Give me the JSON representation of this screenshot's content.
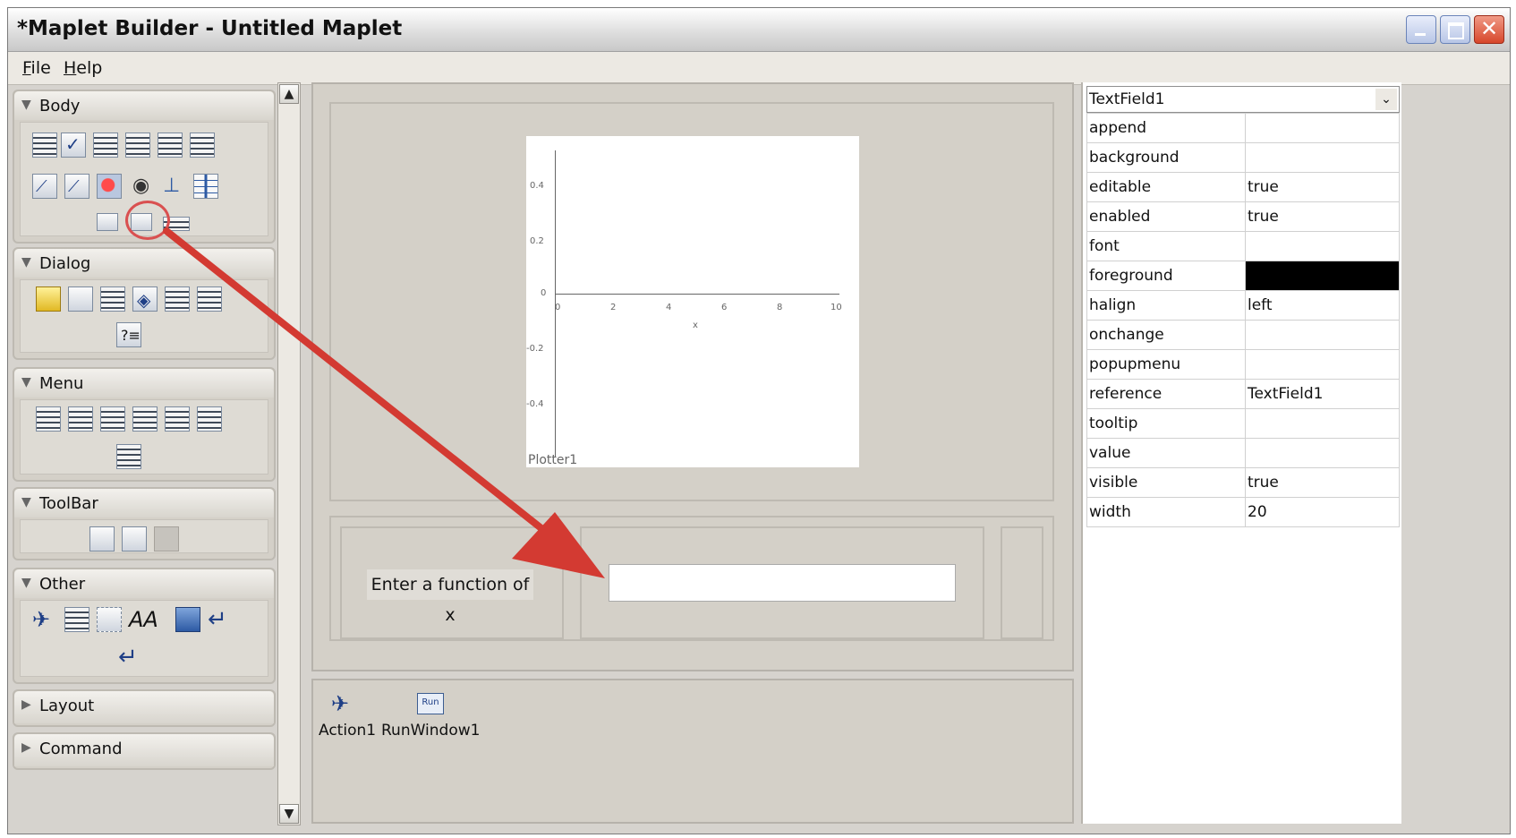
{
  "window": {
    "title": "*Maplet Builder - Untitled Maplet"
  },
  "menu": [
    {
      "label": "File"
    },
    {
      "label": "Help"
    }
  ],
  "palette": {
    "sections": [
      {
        "label": "Body",
        "expanded": true
      },
      {
        "label": "Dialog",
        "expanded": true
      },
      {
        "label": "Menu",
        "expanded": true
      },
      {
        "label": "ToolBar",
        "expanded": true
      },
      {
        "label": "Other",
        "expanded": true
      },
      {
        "label": "Layout",
        "expanded": false
      },
      {
        "label": "Command",
        "expanded": false
      }
    ]
  },
  "design": {
    "plotter": {
      "caption": "Plotter1",
      "x_axis_label": "x",
      "x_ticks": [
        "0",
        "2",
        "4",
        "6",
        "8",
        "10"
      ],
      "y_ticks": [
        "0.4",
        "0.2",
        "0",
        "-0.2",
        "-0.4"
      ]
    },
    "label_text": "Enter a function of x",
    "textfield_value": ""
  },
  "command_items": [
    {
      "label": "Action1",
      "icon": "runner-icon"
    },
    {
      "label": "RunWindow1",
      "icon": "run-window-icon",
      "icon_text": "Run"
    }
  ],
  "properties": {
    "selected_component": "TextField1",
    "rows": [
      {
        "name": "append",
        "value": ""
      },
      {
        "name": "background",
        "value": ""
      },
      {
        "name": "editable",
        "value": "true"
      },
      {
        "name": "enabled",
        "value": "true"
      },
      {
        "name": "font",
        "value": ""
      },
      {
        "name": "foreground",
        "value": "",
        "color": "#000000"
      },
      {
        "name": "halign",
        "value": "left"
      },
      {
        "name": "onchange",
        "value": ""
      },
      {
        "name": "popupmenu",
        "value": ""
      },
      {
        "name": "reference",
        "value": "TextField1"
      },
      {
        "name": "tooltip",
        "value": ""
      },
      {
        "name": "value",
        "value": ""
      },
      {
        "name": "visible",
        "value": "true"
      },
      {
        "name": "width",
        "value": "20"
      }
    ]
  },
  "colors": {
    "annotation_arrow": "#d33a32"
  }
}
